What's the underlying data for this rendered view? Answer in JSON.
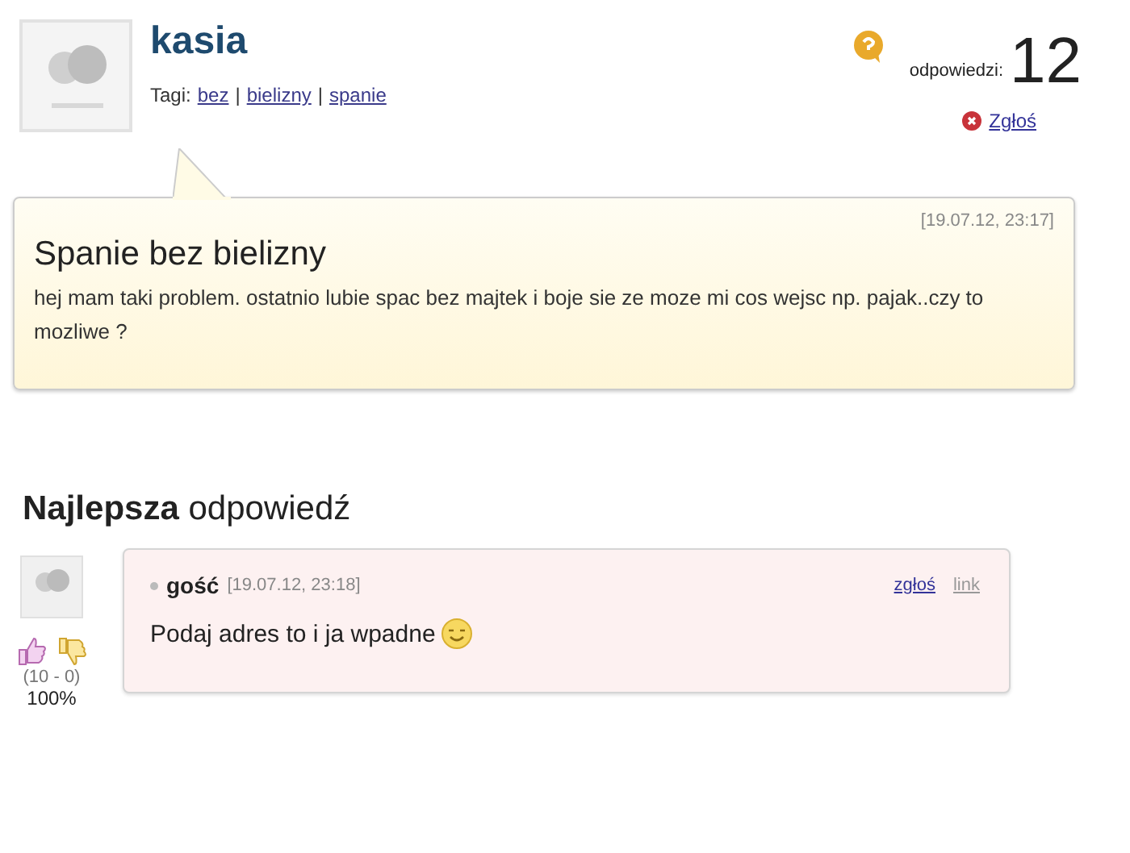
{
  "question": {
    "author": "kasia",
    "tags_label": "Tagi:",
    "tags": [
      {
        "kind": "link",
        "label": "bez"
      },
      {
        "kind": "separator",
        "label": "|"
      },
      {
        "kind": "link",
        "label": "bielizny"
      },
      {
        "kind": "separator",
        "label": "|"
      },
      {
        "kind": "link",
        "label": "spanie"
      }
    ],
    "answers_label": "odpowiedzi:",
    "answers_count": "12",
    "report": "Zgłoś",
    "date": "[19.07.12, 23:17]",
    "title": "Spanie bez bielizny",
    "body": "hej mam taki problem. ostatnio lubie spac bez majtek i boje sie ze moze mi cos wejsc np. pajak..czy to mozliwe ?"
  },
  "best_answer": {
    "heading": "**Najlepsza** odpowiedź",
    "author": "gość",
    "date": "[19.07.12, 23:18]",
    "report": "zgłoś",
    "link": "link",
    "text": "Podaj adres to i ja wpadne",
    "votes": "(10 - 0)",
    "percent": "100%"
  }
}
